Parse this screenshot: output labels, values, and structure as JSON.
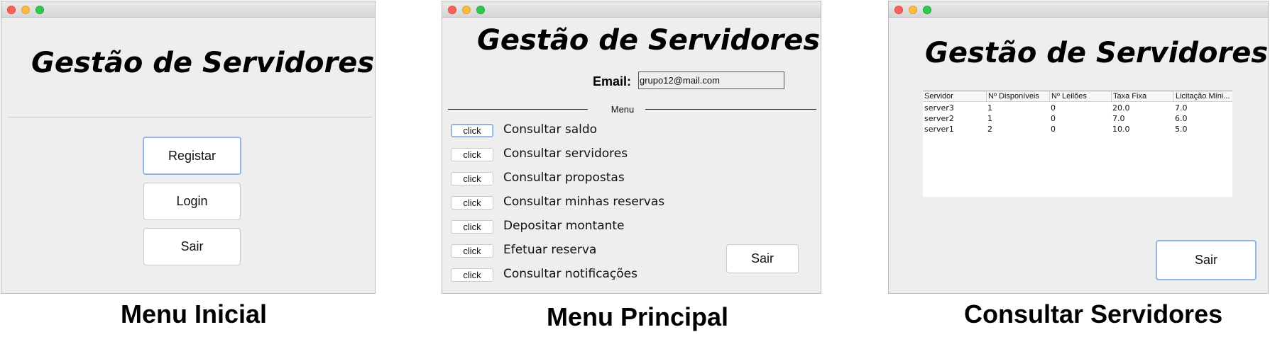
{
  "captions": {
    "left": "Menu Inicial",
    "center": "Menu Principal",
    "right": "Consultar Servidores"
  },
  "menu_inicial": {
    "title": "Gestão de Servidores",
    "buttons": {
      "registar": "Registar",
      "login": "Login",
      "sair": "Sair"
    }
  },
  "menu_principal": {
    "title": "Gestão de Servidores",
    "email_label": "Email:",
    "email_value": "grupo12@mail.com",
    "menu_label": "Menu",
    "items": [
      {
        "button": "click",
        "label": "Consultar saldo"
      },
      {
        "button": "click",
        "label": "Consultar servidores"
      },
      {
        "button": "click",
        "label": "Consultar propostas"
      },
      {
        "button": "click",
        "label": "Consultar minhas reservas"
      },
      {
        "button": "click",
        "label": "Depositar montante"
      },
      {
        "button": "click",
        "label": "Efetuar reserva"
      },
      {
        "button": "click",
        "label": "Consultar notificações"
      }
    ],
    "sair": "Sair"
  },
  "consultar_servidores": {
    "title": "Gestão de Servidores",
    "table": {
      "columns": [
        "Servidor",
        "Nº Disponíveis",
        "Nº Leilões",
        "Taxa Fixa",
        "Licitação Míni..."
      ],
      "rows": [
        [
          "server3",
          "1",
          "0",
          "20.0",
          "7.0"
        ],
        [
          "server2",
          "1",
          "0",
          "7.0",
          "6.0"
        ],
        [
          "server1",
          "2",
          "0",
          "10.0",
          "5.0"
        ]
      ]
    },
    "sair": "Sair"
  }
}
